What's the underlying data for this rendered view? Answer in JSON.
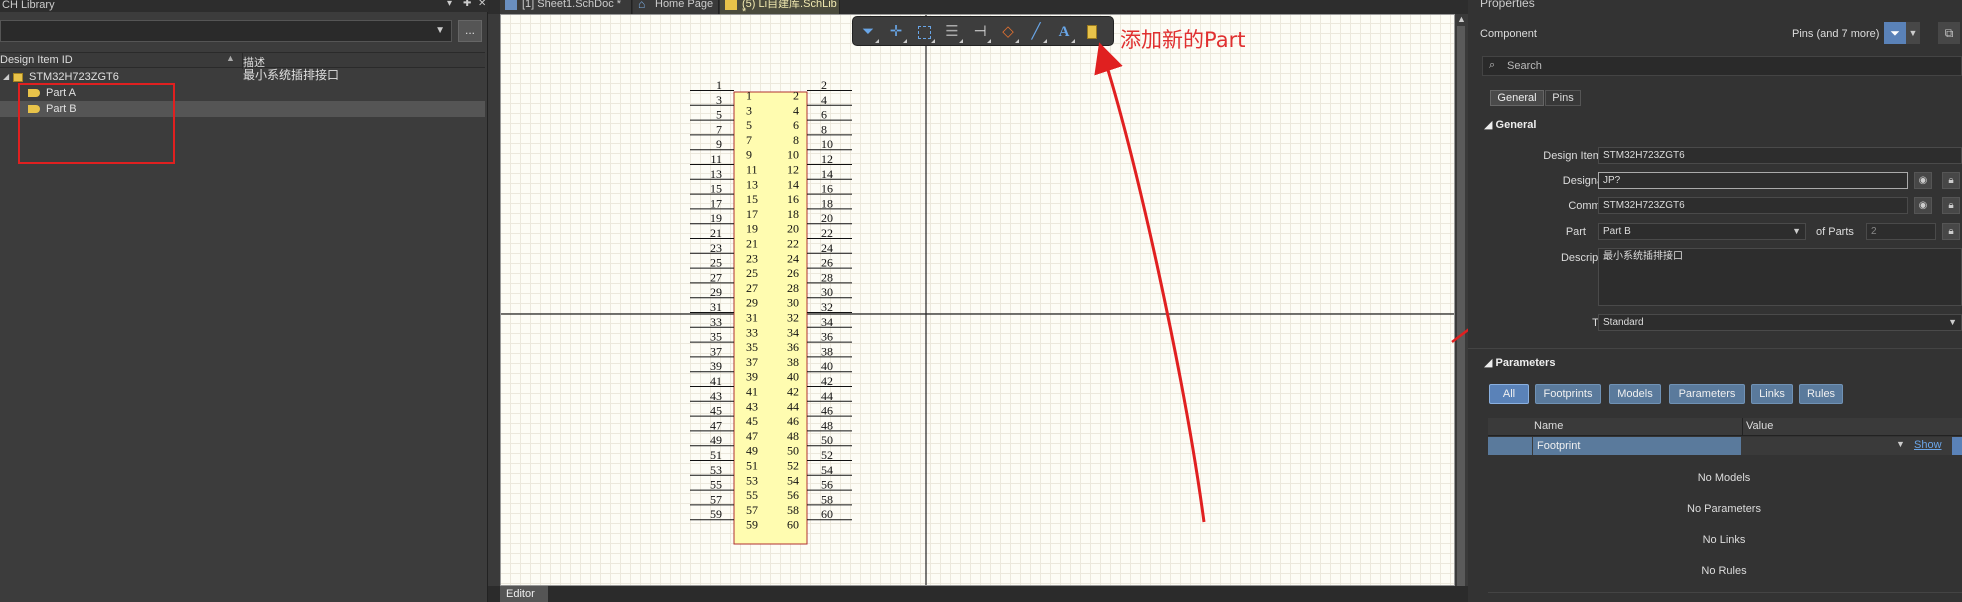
{
  "left_panel": {
    "title": "CH Library",
    "ctl_icons": [
      "pin-icon",
      "close-icon"
    ],
    "more_button": "...",
    "col_id": "Design Item ID",
    "col_desc": "描述",
    "component_id": "STM32H723ZGT6",
    "component_desc": "最小系统插排接口",
    "parts": [
      "Part A",
      "Part B"
    ]
  },
  "tabs": [
    {
      "label": "[1] Sheet1.SchDoc *",
      "icon": "schematic-icon"
    },
    {
      "label": "Home Page",
      "icon": "home-icon"
    },
    {
      "label": "(5) Li自建库.SchLib *",
      "icon": "schlib-icon"
    }
  ],
  "editor_tab": "Editor",
  "annotation": "添加新的Part",
  "toolbar": [
    "filter-icon",
    "move-icon",
    "select-rect-icon",
    "align-icon",
    "place-pin-icon",
    "fill-icon",
    "line-icon",
    "text-icon",
    "add-part-icon"
  ],
  "symbol": {
    "pins_left": [
      "1",
      "3",
      "5",
      "7",
      "9",
      "11",
      "13",
      "15",
      "17",
      "19",
      "21",
      "23",
      "25",
      "27",
      "29",
      "31",
      "33",
      "35",
      "37",
      "39",
      "41",
      "43",
      "45",
      "47",
      "49",
      "51",
      "53",
      "55",
      "57",
      "59"
    ],
    "pins_right": [
      "2",
      "4",
      "6",
      "8",
      "10",
      "12",
      "14",
      "16",
      "18",
      "20",
      "22",
      "24",
      "26",
      "28",
      "30",
      "32",
      "34",
      "36",
      "38",
      "40",
      "42",
      "44",
      "46",
      "48",
      "50",
      "52",
      "54",
      "56",
      "58",
      "60"
    ]
  },
  "properties": {
    "title": "Properties",
    "component_label": "Component",
    "filter_summary": "Pins (and 7 more)",
    "search_placeholder": "Search",
    "tabs": [
      "General",
      "Pins"
    ],
    "general_header": "General",
    "fields": {
      "design_item_id_label": "Design Item ID",
      "design_item_id": "STM32H723ZGT6",
      "designator_label": "Designator",
      "designator": "JP?",
      "comment_label": "Comment",
      "comment": "STM32H723ZGT6",
      "part_label": "Part",
      "part": "Part B",
      "of_parts_label": "of Parts",
      "of_parts": "2",
      "description_label": "Description",
      "description": "最小系统插排接口",
      "type_label": "Type",
      "type": "Standard"
    },
    "parameters_header": "Parameters",
    "param_buttons": [
      "All",
      "Footprints",
      "Models",
      "Parameters",
      "Links",
      "Rules"
    ],
    "table_headers": [
      "Name",
      "Value"
    ],
    "footprint_row": "Footprint",
    "show_link": "Show",
    "empty_messages": [
      "No Models",
      "No Parameters",
      "No Links",
      "No Rules"
    ]
  },
  "colors": {
    "accent_red": "#e02020",
    "symbol_fill": "#fffcb0",
    "symbol_border": "#b03030"
  }
}
